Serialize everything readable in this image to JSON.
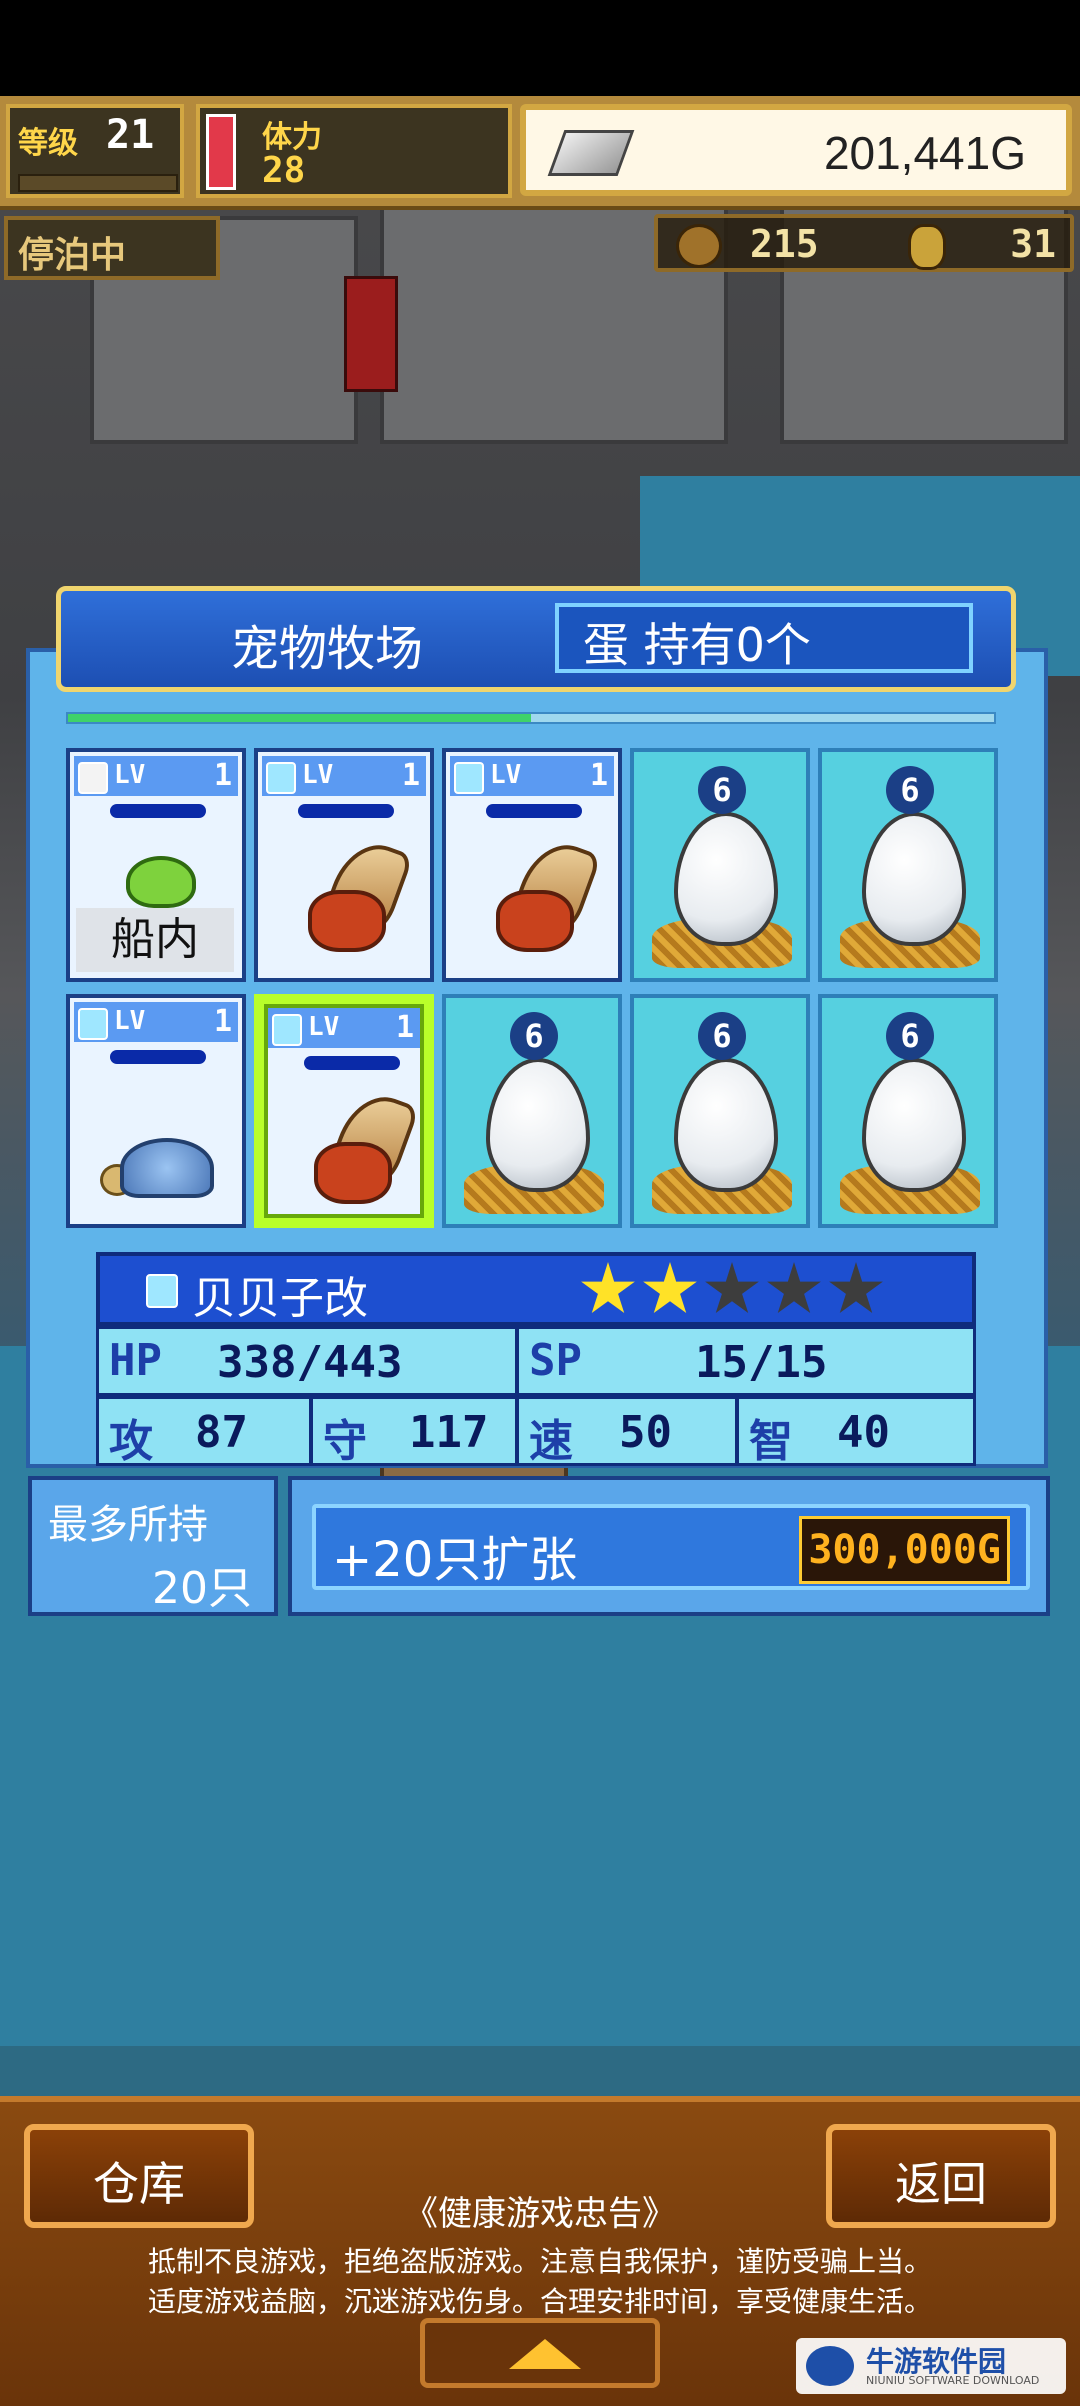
{
  "hud": {
    "level_label": "等级",
    "level_value": "21",
    "stamina_label": "体力",
    "stamina_value": "28",
    "gold": "201,441G",
    "docked_label": "停泊中",
    "resource_a": "215",
    "resource_b": "31"
  },
  "panel": {
    "title": "宠物牧场",
    "eggs_owned": "蛋 持有0个",
    "progress_fraction": 0.5
  },
  "pets": [
    {
      "type": "pet",
      "species_icon": "slime-icon",
      "gem": "white",
      "lv_label": "LV",
      "level": "1",
      "location": "船内"
    },
    {
      "type": "pet",
      "species_icon": "hermit-crab-icon",
      "gem": "blue",
      "lv_label": "LV",
      "level": "1"
    },
    {
      "type": "pet",
      "species_icon": "hermit-crab-icon",
      "gem": "blue",
      "lv_label": "LV",
      "level": "1"
    },
    {
      "type": "egg",
      "hatch_count": "6"
    },
    {
      "type": "egg",
      "hatch_count": "6"
    },
    {
      "type": "pet",
      "species_icon": "turtle-icon",
      "gem": "blue",
      "lv_label": "LV",
      "level": "1"
    },
    {
      "type": "pet",
      "species_icon": "hermit-crab-icon",
      "gem": "blue",
      "lv_label": "LV",
      "level": "1",
      "selected": true
    },
    {
      "type": "egg",
      "hatch_count": "6"
    },
    {
      "type": "egg",
      "hatch_count": "6"
    },
    {
      "type": "egg",
      "hatch_count": "6"
    }
  ],
  "selected_pet": {
    "name": "贝贝子改",
    "stars": 2,
    "stars_max": 5,
    "hp_label": "HP",
    "hp": "338/443",
    "sp_label": "SP",
    "sp": "15/15",
    "atk_label": "攻",
    "atk": "87",
    "def_label": "守",
    "def": "117",
    "spd_label": "速",
    "spd": "50",
    "int_label": "智",
    "int": "40"
  },
  "capacity": {
    "label": "最多所持",
    "value": "20只"
  },
  "expand": {
    "label": "+20只扩张",
    "price": "300,000G"
  },
  "bottom": {
    "warehouse_label": "仓库",
    "back_label": "返回",
    "notice_title": "《健康游戏忠告》",
    "notice_line1": "抵制不良游戏，拒绝盗版游戏。注意自我保护，谨防受骗上当。",
    "notice_line2": "适度游戏益脑，沉迷游戏伤身。合理安排时间，享受健康生活。"
  },
  "watermark": {
    "name": "牛游软件园",
    "sub": "NIUNIU SOFTWARE DOWNLOAD"
  }
}
